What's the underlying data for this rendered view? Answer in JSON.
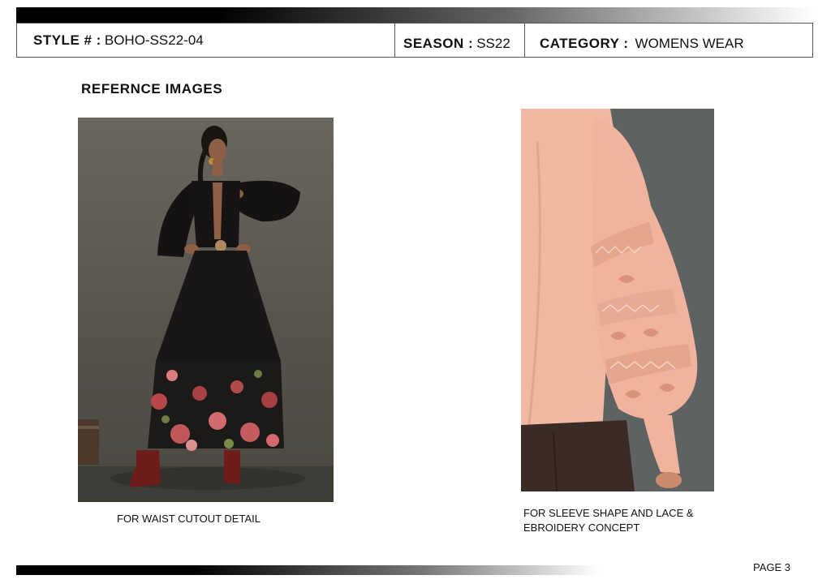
{
  "header": {
    "style_label": "STYLE # :",
    "style_value": "BOHO-SS22-04",
    "season_label": "SEASON :",
    "season_value": "SS22",
    "category_label": "CATEGORY :",
    "category_value": "WOMENS WEAR"
  },
  "section_title": "REFERNCE IMAGES",
  "images": [
    {
      "caption": "FOR WAIST CUTOUT DETAIL"
    },
    {
      "caption": "FOR SLEEVE SHAPE AND LACE & EBROIDERY CONCEPT"
    }
  ],
  "footer": {
    "page_label": "PAGE 3"
  }
}
